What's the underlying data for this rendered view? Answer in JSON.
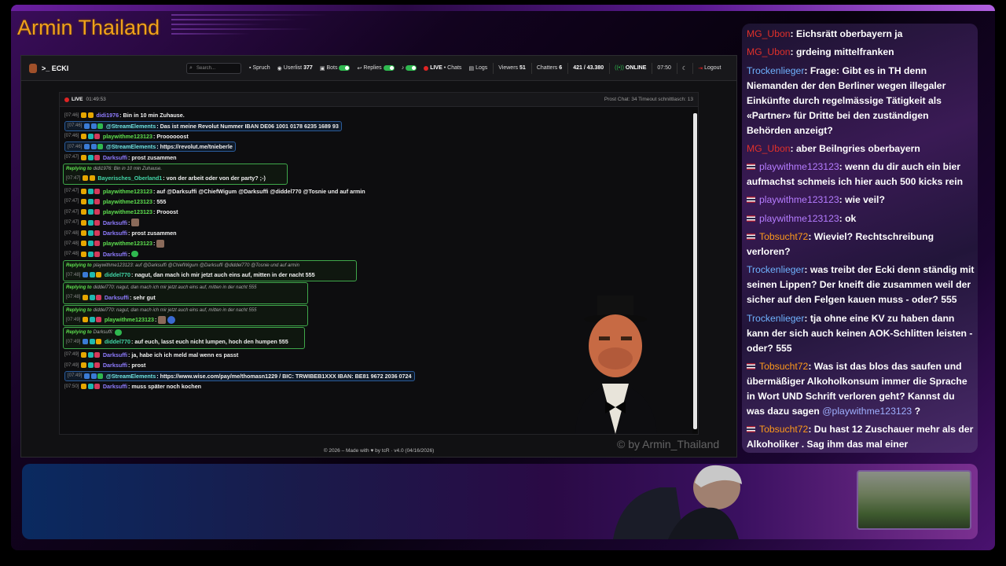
{
  "overlay": {
    "brand": "Armin Thailand",
    "watermark": "© by Armin_Thailand"
  },
  "topbar": {
    "title": "ECKI",
    "search_placeholder": "Search...",
    "spruch": "Spruch",
    "userlist_label": "Userlist",
    "userlist_count": "377",
    "bots": "Bots",
    "replies": "Replies",
    "live": "LIVE",
    "chats": "• Chats",
    "logs": "Logs",
    "viewers_label": "Viewers",
    "viewers_count": "51",
    "chatters_label": "Chatters",
    "chatters_count": "6",
    "followers": "421 / 43.380",
    "online": "ONLINE",
    "clock": "07:50",
    "logout": "Logout"
  },
  "status": {
    "live": "LIVE",
    "duration": "01:49:53",
    "stats": "Prost Chat: 34   Timeout schnittlasch: 13"
  },
  "chat": {
    "m1": {
      "ts": "[07:46]",
      "user": "didi1976",
      "text": ": Bin in 10 min Zuhause."
    },
    "m2": {
      "ts": "[07:46]",
      "user": "@StreamElements",
      "text": ": Das ist meine Revolut Nummer IBAN DE06 1001 0178 6235 1689 93"
    },
    "m3": {
      "ts": "[07:46]",
      "user": "playwithme123123",
      "text": ": Proooooost"
    },
    "m4": {
      "ts": "[07:46]",
      "user": "@StreamElements",
      "text": ": https://revolut.me/tnieberle"
    },
    "m5": {
      "ts": "[07:47]",
      "user": "Darksuffi",
      "text": ": prost zusammen"
    },
    "m6": {
      "reply_label": "Replying to",
      "reply_text": "didi1976: Bin in 10 min Zuhause.",
      "ts": "[07:47]",
      "user": "Bayerisches_Oberland1",
      "text": ": von der arbeit oder von der party? ;-)"
    },
    "m7": {
      "ts": "[07:47]",
      "user": "playwithme123123",
      "text": ": auf @Darksuffi @ChiefWigum @Darksuffi @diddel770 @Tosnie und auf armin"
    },
    "m8": {
      "ts": "[07:47]",
      "user": "playwithme123123",
      "text": ": 555"
    },
    "m9": {
      "ts": "[07:47]",
      "user": "playwithme123123",
      "text": ": Prooost"
    },
    "m10": {
      "ts": "[07:47]",
      "user": "Darksuffi",
      "text": ":"
    },
    "m11": {
      "ts": "[07:48]",
      "user": "Darksuffi",
      "text": ": prost zusammen"
    },
    "m12": {
      "ts": "[07:48]",
      "user": "playwithme123123",
      "text": ":"
    },
    "m13": {
      "ts": "[07:48]",
      "user": "Darksuffi",
      "text": ":"
    },
    "m14": {
      "reply_label": "Replying to",
      "reply_text": "playwithme123123: auf @Darksuffi @ChiefWigum @Darksuffi @diddel770 @Tosnie und auf armin",
      "ts": "[07:48]",
      "user": "diddel770",
      "text": ": nagut, dan mach ich mir jetzt auch eins auf, mitten in der nacht 555"
    },
    "m15": {
      "reply_label": "Replying to",
      "reply_text": "diddel770: nagut, dan mach ich mir jetzt auch eins auf, mitten in der nacht 555",
      "ts": "[07:48]",
      "user": "Darksuffi",
      "text": ": sehr gut"
    },
    "m16": {
      "reply_label": "Replying to",
      "reply_text": "diddel770: nagut, dan mach ich mir jetzt auch eins auf, mitten in der nacht 555",
      "ts": "[07:49]",
      "user": "playwithme123123",
      "text": ":"
    },
    "m17": {
      "reply_label": "Replying to",
      "reply_text": "Darksuffi:",
      "ts": "[07:49]",
      "user": "diddel770",
      "text": ": auf euch, lasst euch nicht lumpen, hoch den humpen 555"
    },
    "m18": {
      "ts": "[07:49]",
      "user": "Darksuffi",
      "text": ": ja, habe ich ich meld mal wenn es passt"
    },
    "m19": {
      "ts": "[07:49]",
      "user": "Darksuffi",
      "text": ": prost"
    },
    "m20": {
      "ts": "[07:49]",
      "user": "@StreamElements",
      "text": ": https://www.wise.com/pay/me/thomasn1229 / BIC: TRWIBEB1XXX IBAN: BE81 9672 2036 0724"
    },
    "m21": {
      "ts": "[07:50]",
      "user": "Darksuffi",
      "text": ": muss später noch kochen"
    }
  },
  "footer": "© 2026 – Made with ♥ by tcR · v4.0 (04/16/2026)",
  "side": {
    "s1": {
      "user": "MG_Ubon",
      "text": ": Eichsrätt oberbayern ja"
    },
    "s2": {
      "user": "MG_Ubon",
      "text": ": grdeing mittelfranken"
    },
    "s3": {
      "user": "Trockenlieger",
      "text": ": Frage: Gibt es in TH denn Niemanden der den Berliner wegen illegaler Einkünfte durch regelmässige Tätigkeit als «Partner» für Dritte bei den zuständigen Behörden anzeigt?"
    },
    "s4": {
      "user": "MG_Ubon",
      "text": ": aber Beilngries oberbayern"
    },
    "s5": {
      "user": "playwithme123123",
      "text": ": wenn du dir auch ein bier aufmachst schmeis ich hier auch 500 kicks rein"
    },
    "s6": {
      "user": "playwithme123123",
      "text": ": wie veil?"
    },
    "s7": {
      "user": "playwithme123123",
      "text": ": ok"
    },
    "s8": {
      "user": "Tobsucht72",
      "text": ": Wieviel? Rechtschreibung verloren?"
    },
    "s9": {
      "user": "Trockenlieger",
      "text": ": was treibt der Ecki denn ständig mit seinen Lippen? Der kneift die zusammen weil der sicher auf den Felgen kauen muss - oder? 555"
    },
    "s10": {
      "user": "Trockenlieger",
      "text": ": tja ohne eine KV zu haben dann kann der sich auch keinen AOK-Schlitten leisten - oder? 555"
    },
    "s11": {
      "user": "Tobsucht72",
      "text": ": Was ist das blos das saufen und übermäßiger Alkoholkonsum immer die Sprache in Wort UND Schrift verloren geht? Kannst du was dazu sagen",
      "mention": "@playwithme123123",
      "tail": "?"
    },
    "s12": {
      "user": "Tobsucht72",
      "text": ": Du hast 12 Zuschauer mehr als der Alkoholiker . Sag ihm das mal einer"
    }
  },
  "colors": {
    "brand": "#f0a21a",
    "accent_green": "#2fb84f",
    "live_red": "#e02424"
  }
}
